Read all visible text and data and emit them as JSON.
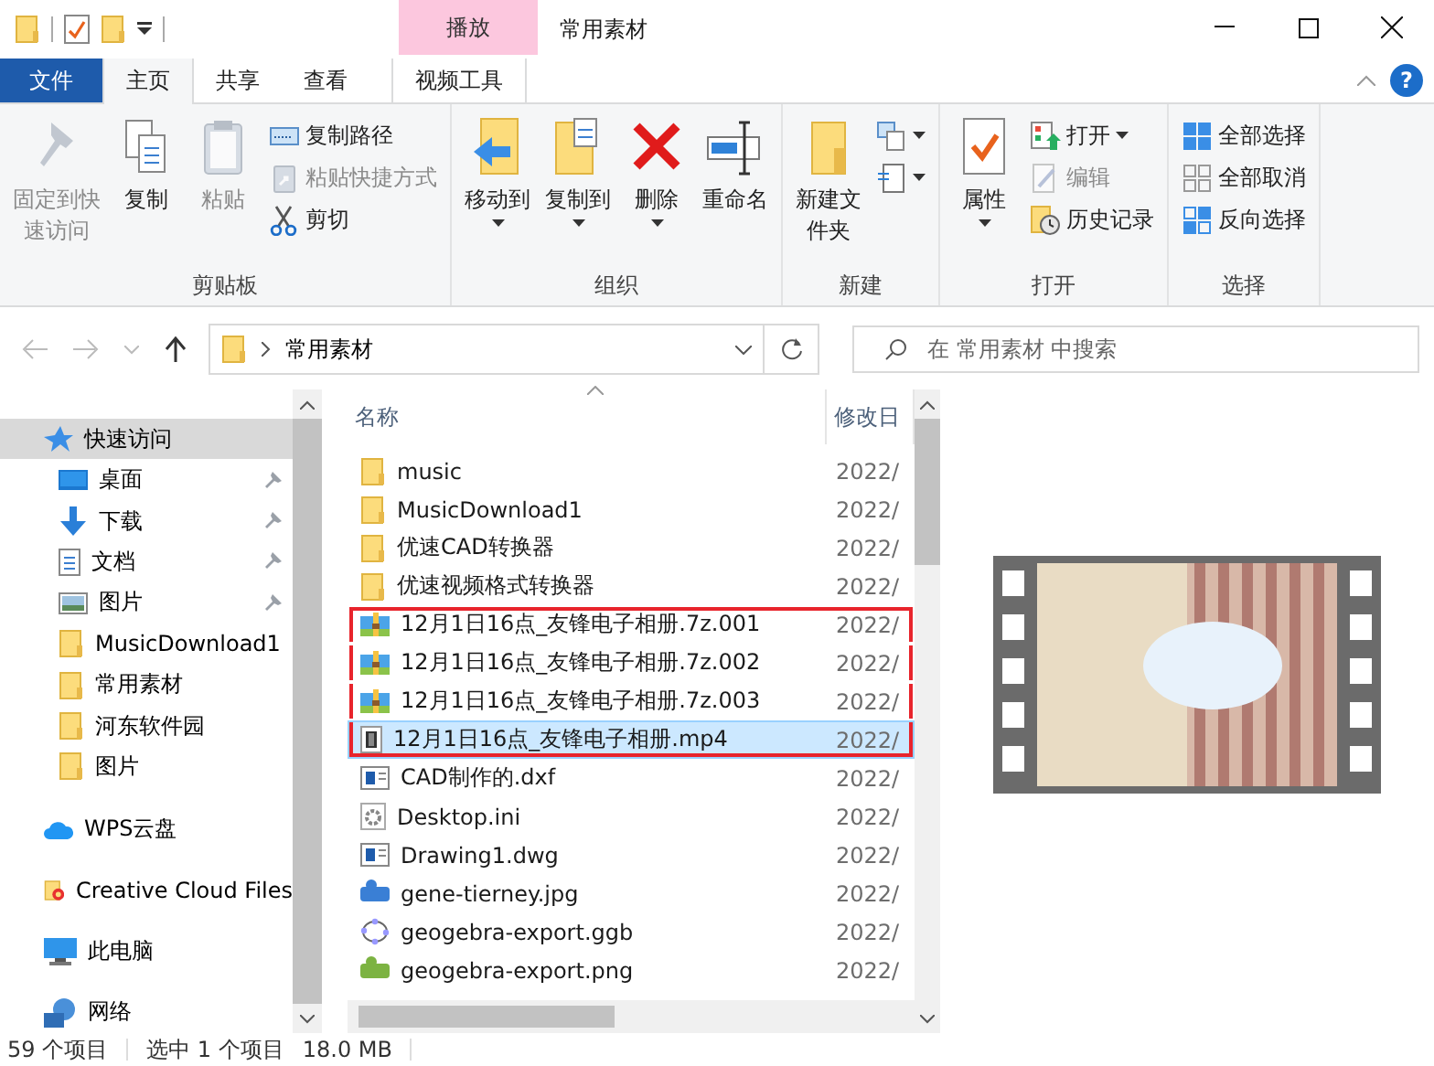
{
  "window": {
    "title": "常用素材",
    "context_group": "播放",
    "help": "?"
  },
  "tabs": [
    {
      "label": "文件",
      "kind": "file",
      "selected": false
    },
    {
      "label": "主页",
      "kind": "tab",
      "selected": true
    },
    {
      "label": "共享",
      "kind": "tab",
      "selected": false
    },
    {
      "label": "查看",
      "kind": "tab",
      "selected": false
    },
    {
      "label": "视频工具",
      "kind": "context",
      "selected": false
    }
  ],
  "ribbon": [
    {
      "label": "剪贴板",
      "items": [
        {
          "label": "固定到快速访问",
          "kind": "large",
          "disabled": true,
          "dropdown": false
        },
        {
          "label": "复制",
          "kind": "large",
          "disabled": false,
          "dropdown": false
        },
        {
          "label": "粘贴",
          "kind": "large",
          "disabled": true,
          "dropdown": false
        },
        {
          "label": "复制路径",
          "kind": "small",
          "disabled": false,
          "dropdown": false
        },
        {
          "label": "粘贴快捷方式",
          "kind": "small",
          "disabled": true,
          "dropdown": false
        },
        {
          "label": "剪切",
          "kind": "small",
          "disabled": false,
          "dropdown": false
        }
      ]
    },
    {
      "label": "组织",
      "items": [
        {
          "label": "移动到",
          "kind": "large",
          "disabled": false,
          "dropdown": true
        },
        {
          "label": "复制到",
          "kind": "large",
          "disabled": false,
          "dropdown": true
        },
        {
          "label": "删除",
          "kind": "large",
          "disabled": false,
          "dropdown": true
        },
        {
          "label": "重命名",
          "kind": "large",
          "disabled": false,
          "dropdown": false
        }
      ]
    },
    {
      "label": "新建",
      "items": [
        {
          "label": "新建文件夹",
          "kind": "large",
          "disabled": false,
          "dropdown": false
        },
        {
          "kind": "small",
          "disabled": false,
          "dropdown": true
        },
        {
          "kind": "small",
          "disabled": false,
          "dropdown": true
        }
      ]
    },
    {
      "label": "打开",
      "items": [
        {
          "label": "属性",
          "kind": "large",
          "disabled": false,
          "dropdown": true
        },
        {
          "label": "打开",
          "kind": "small",
          "disabled": false,
          "dropdown": true
        },
        {
          "label": "编辑",
          "kind": "small",
          "disabled": true,
          "dropdown": false
        },
        {
          "label": "历史记录",
          "kind": "small",
          "disabled": false,
          "dropdown": false
        }
      ]
    },
    {
      "label": "选择",
      "items": [
        {
          "label": "全部选择",
          "kind": "small",
          "disabled": false,
          "dropdown": false
        },
        {
          "label": "全部取消",
          "kind": "small",
          "disabled": false,
          "dropdown": false
        },
        {
          "label": "反向选择",
          "kind": "small",
          "disabled": false,
          "dropdown": false
        }
      ]
    }
  ],
  "address": {
    "breadcrumb": "常用素材",
    "search_placeholder": "在 常用素材 中搜索"
  },
  "sidebar": {
    "items": [
      {
        "label": "快速访问",
        "kind": "star",
        "selected": true,
        "children": [
          {
            "label": "桌面",
            "kind": "desktop",
            "selected": false,
            "pinned": true
          },
          {
            "label": "下载",
            "kind": "downloads",
            "selected": false,
            "pinned": true
          },
          {
            "label": "文档",
            "kind": "documents",
            "selected": false,
            "pinned": true
          },
          {
            "label": "图片",
            "kind": "pictures",
            "selected": false,
            "pinned": true
          },
          {
            "label": "MusicDownload1",
            "kind": "folder",
            "selected": false,
            "pinned": false
          },
          {
            "label": "常用素材",
            "kind": "folder",
            "selected": false,
            "pinned": false
          },
          {
            "label": "河东软件园",
            "kind": "folder",
            "selected": false,
            "pinned": false
          },
          {
            "label": "图片",
            "kind": "folder",
            "selected": false,
            "pinned": false
          }
        ]
      },
      {
        "label": "WPS云盘",
        "kind": "cloud",
        "selected": false
      },
      {
        "label": "Creative Cloud Files",
        "kind": "cc",
        "selected": false
      },
      {
        "label": "此电脑",
        "kind": "pc",
        "selected": false
      },
      {
        "label": "网络",
        "kind": "network",
        "selected": false
      }
    ]
  },
  "table": {
    "columns": [
      "名称",
      "修改日"
    ],
    "rows": [
      {
        "name": "music",
        "date": "2022/",
        "kind": "folder",
        "selected": false,
        "framed": false
      },
      {
        "name": "MusicDownload1",
        "date": "2022/",
        "kind": "folder",
        "selected": false,
        "framed": false
      },
      {
        "name": "优速CAD转换器",
        "date": "2022/",
        "kind": "folder",
        "selected": false,
        "framed": false
      },
      {
        "name": "优速视频格式转换器",
        "date": "2022/",
        "kind": "folder",
        "selected": false,
        "framed": false
      },
      {
        "name": "12月1日16点_友锋电子相册.7z.001",
        "date": "2022/",
        "kind": "archive",
        "selected": false,
        "framed": true
      },
      {
        "name": "12月1日16点_友锋电子相册.7z.002",
        "date": "2022/",
        "kind": "archive",
        "selected": false,
        "framed": true
      },
      {
        "name": "12月1日16点_友锋电子相册.7z.003",
        "date": "2022/",
        "kind": "archive",
        "selected": false,
        "framed": true
      },
      {
        "name": "12月1日16点_友锋电子相册.mp4",
        "date": "2022/",
        "kind": "video",
        "selected": true,
        "framed": true
      },
      {
        "name": "CAD制作的.dxf",
        "date": "2022/",
        "kind": "cad",
        "selected": false,
        "framed": false
      },
      {
        "name": "Desktop.ini",
        "date": "2022/",
        "kind": "settings",
        "selected": false,
        "framed": false
      },
      {
        "name": "Drawing1.dwg",
        "date": "2022/",
        "kind": "cad",
        "selected": false,
        "framed": false
      },
      {
        "name": "gene-tierney.jpg",
        "date": "2022/",
        "kind": "jpg",
        "selected": false,
        "framed": false
      },
      {
        "name": "geogebra-export.ggb",
        "date": "2022/",
        "kind": "ggb",
        "selected": false,
        "framed": false
      },
      {
        "name": "geogebra-export.png",
        "date": "2022/",
        "kind": "png",
        "selected": false,
        "framed": false
      }
    ]
  },
  "status_bar": {
    "count": "59 个项目",
    "selection": "选中 1 个项目",
    "size": "18.0 MB"
  }
}
